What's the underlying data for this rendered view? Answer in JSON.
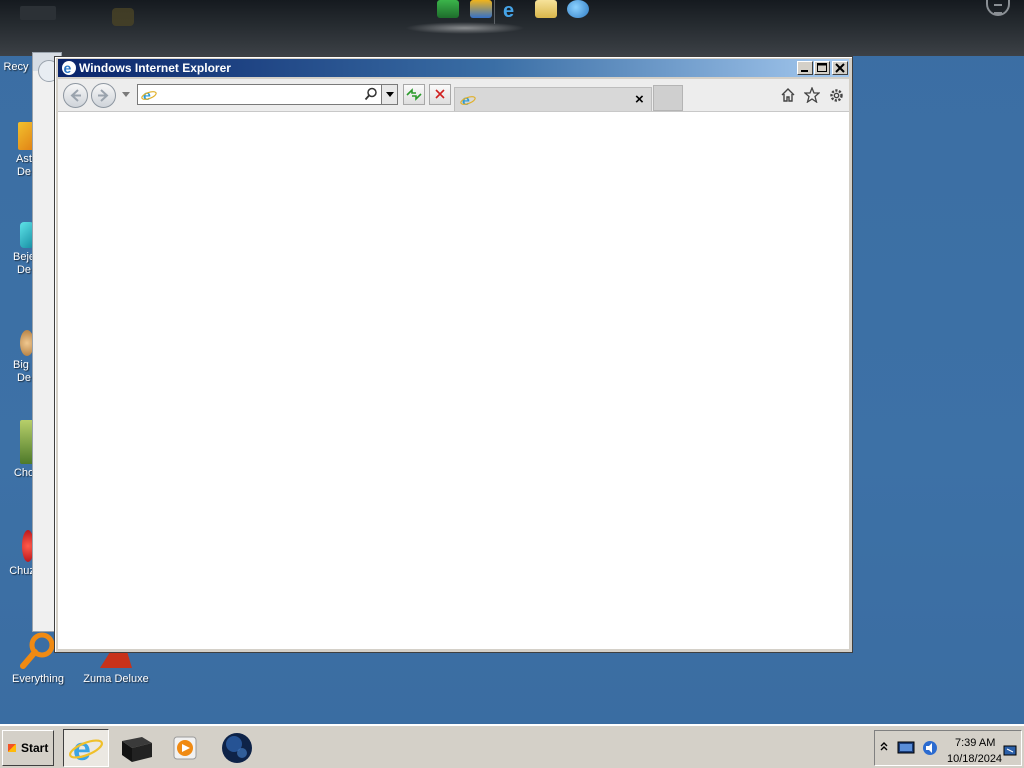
{
  "window": {
    "title": "Windows Internet Explorer",
    "minimize_label": "_",
    "maximize_label": "□",
    "close_label": "×"
  },
  "toolbar": {
    "address_value": "",
    "address_placeholder": "",
    "tab_title": "",
    "tab_close_label": "×"
  },
  "desktop": {
    "icons": [
      {
        "label": "Recy",
        "icon": "recycle-bin-icon"
      },
      {
        "label": "Ast\nDe",
        "icon": "astro-game-icon"
      },
      {
        "label": "Beje\nDe",
        "icon": "bejeweled-icon"
      },
      {
        "label": "Big I\nDe",
        "icon": "big-game-icon"
      },
      {
        "label": "Cho",
        "icon": "chocolatier-icon"
      },
      {
        "label": "Chuzzl",
        "icon": "chuzzle-icon"
      }
    ],
    "bottom_icons": [
      {
        "label": "Everything",
        "icon": "search-magnifier-icon"
      },
      {
        "label": "Zuma Deluxe",
        "icon": "zuma-icon"
      }
    ]
  },
  "taskbar": {
    "start_label": "Start",
    "items": [
      "internet-explorer-icon",
      "black-box-icon",
      "media-player-icon",
      "globe-icon"
    ],
    "clock_time": "7:39 AM",
    "clock_date": "10/18/2024"
  },
  "colors": {
    "desktop": "#3a6ea5",
    "title_bar_start": "#0a246a",
    "title_bar_end": "#a6caf0",
    "taskbar": "#d4d0c8"
  }
}
